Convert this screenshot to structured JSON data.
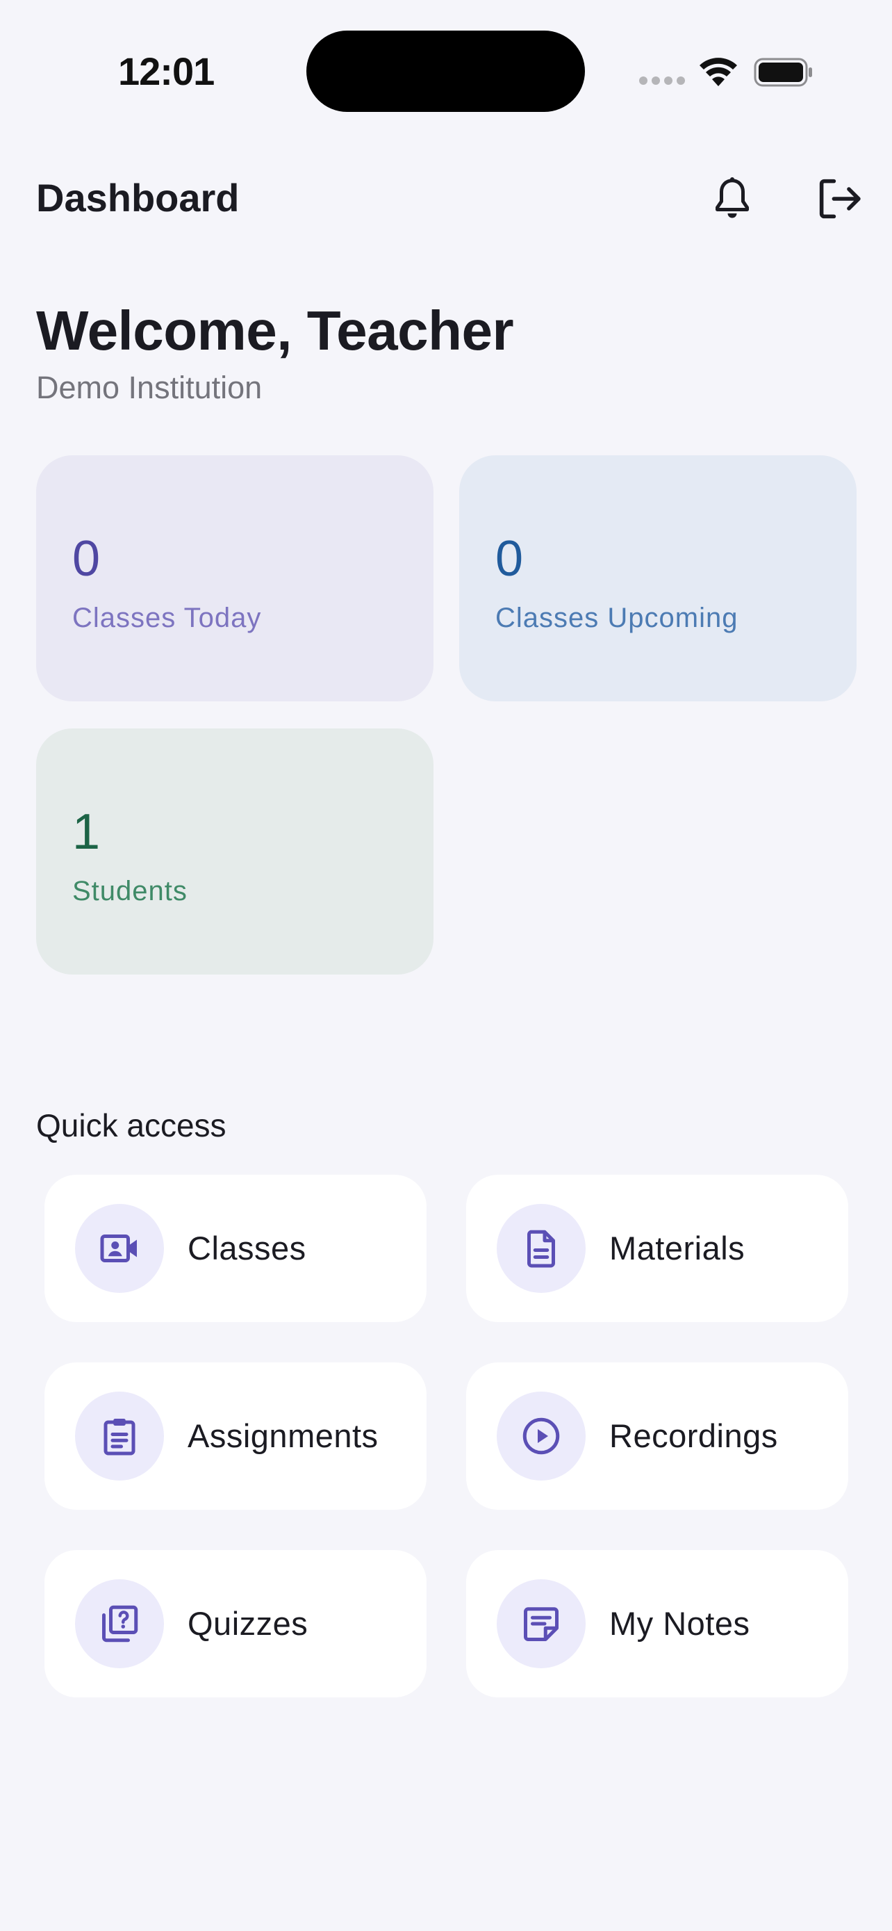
{
  "status_bar": {
    "time": "12:01"
  },
  "app_bar": {
    "title": "Dashboard"
  },
  "welcome": {
    "title": "Welcome, Teacher",
    "subtitle": "Demo Institution"
  },
  "stats": [
    {
      "value": "0",
      "label": "Classes Today"
    },
    {
      "value": "0",
      "label": "Classes Upcoming"
    },
    {
      "value": "1",
      "label": "Students"
    }
  ],
  "quick_access": {
    "title": "Quick access",
    "items": [
      {
        "label": "Classes",
        "icon": "video-contact-icon"
      },
      {
        "label": "Materials",
        "icon": "document-icon"
      },
      {
        "label": "Assignments",
        "icon": "clipboard-icon"
      },
      {
        "label": "Recordings",
        "icon": "play-circle-icon"
      },
      {
        "label": "Quizzes",
        "icon": "quiz-icon"
      },
      {
        "label": "My Notes",
        "icon": "note-icon"
      }
    ]
  },
  "colors": {
    "background": "#f5f5fa",
    "accent": "#5b4fb5",
    "icon_bubble": "#ecebfb"
  }
}
